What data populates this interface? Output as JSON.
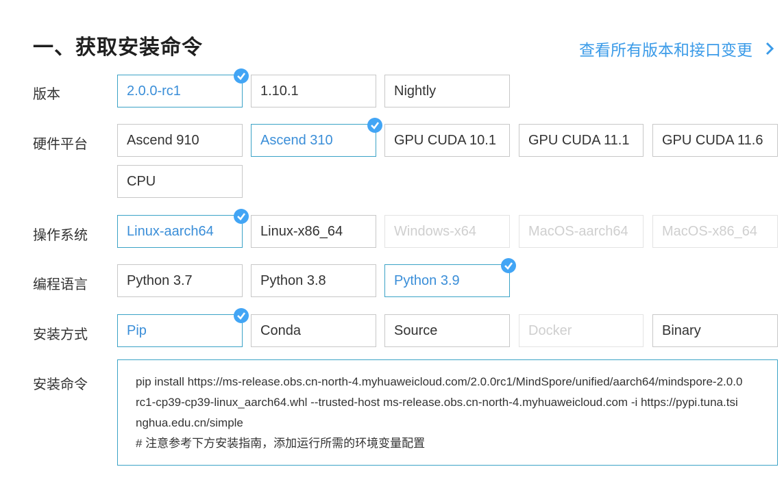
{
  "title": "一、获取安装命令",
  "top_link": "查看所有版本和接口变更",
  "rows": {
    "version": {
      "label": "版本",
      "options": [
        "2.0.0-rc1",
        "1.10.1",
        "Nightly"
      ]
    },
    "hardware": {
      "label": "硬件平台",
      "options": [
        "Ascend 910",
        "Ascend 310",
        "GPU CUDA 10.1",
        "GPU CUDA 11.1",
        "GPU CUDA 11.6",
        "CPU"
      ]
    },
    "os": {
      "label": "操作系统",
      "options": [
        "Linux-aarch64",
        "Linux-x86_64",
        "Windows-x64",
        "MacOS-aarch64",
        "MacOS-x86_64"
      ]
    },
    "language": {
      "label": "编程语言",
      "options": [
        "Python 3.7",
        "Python 3.8",
        "Python 3.9"
      ]
    },
    "method": {
      "label": "安装方式",
      "options": [
        "Pip",
        "Conda",
        "Source",
        "Docker",
        "Binary"
      ]
    },
    "command": {
      "label": "安装命令"
    }
  },
  "command_lines": [
    "pip install https://ms-release.obs.cn-north-4.myhuaweicloud.com/2.0.0rc1/MindSpore/unified/aarch64/mindspore-2.0.0",
    "rc1-cp39-cp39-linux_aarch64.whl --trusted-host ms-release.obs.cn-north-4.myhuaweicloud.com -i https://pypi.tuna.tsi",
    "nghua.edu.cn/simple",
    "# 注意参考下方安装指南，添加运行所需的环境变量配置"
  ],
  "colors": {
    "accent": "#3a8ed8",
    "selected_border": "#3aa2c6",
    "check": "#42a5f5",
    "disabled_text": "#cfcfcf"
  }
}
